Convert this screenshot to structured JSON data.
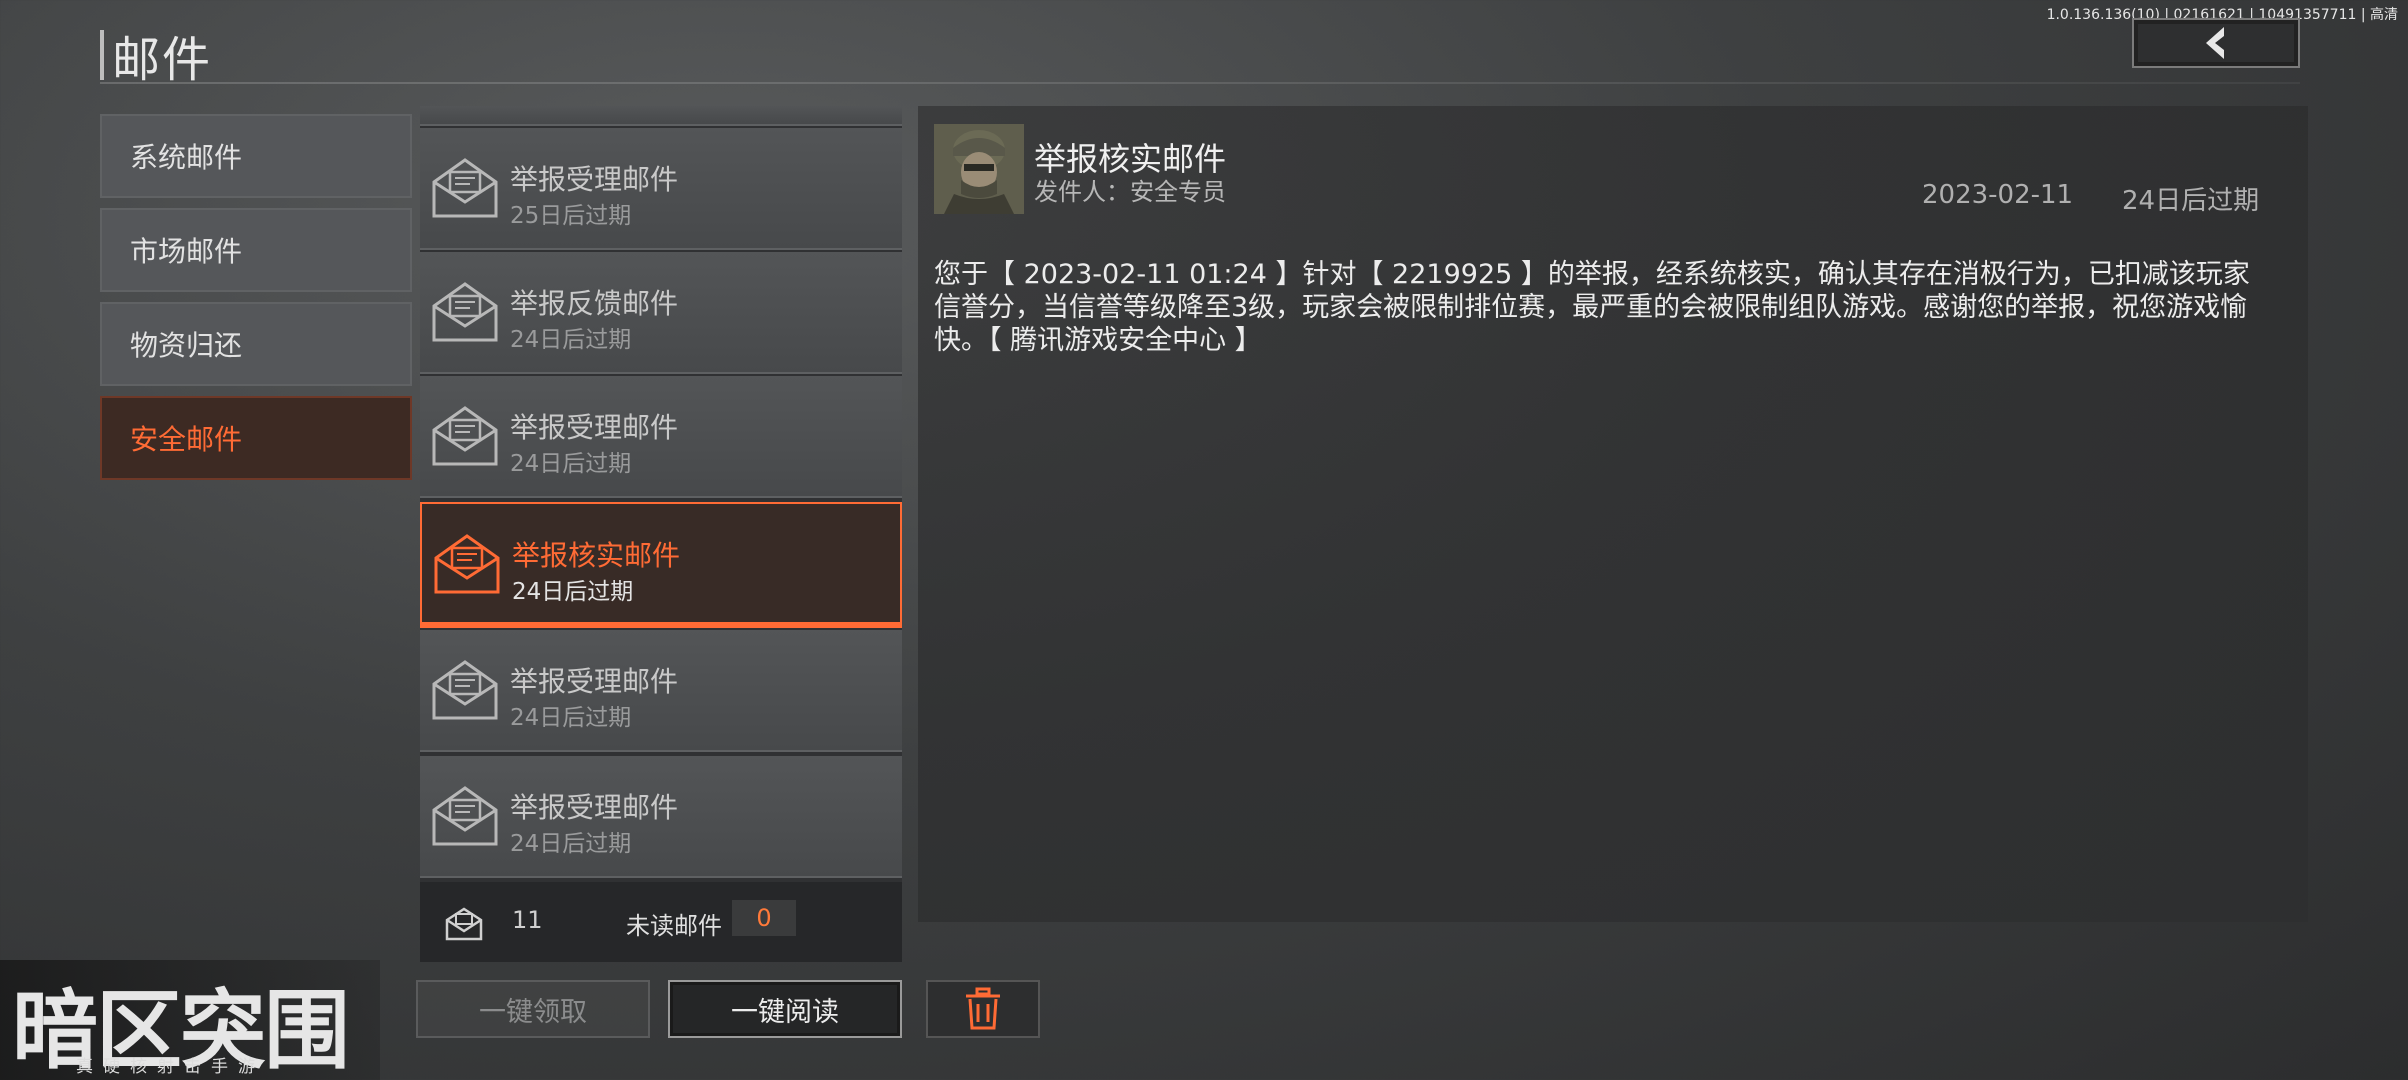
{
  "version": "1.0.136.136(10) | 02161621 | 10491357711 | 高清",
  "header": {
    "title": "邮件"
  },
  "categories": [
    {
      "label": "系统邮件"
    },
    {
      "label": "市场邮件"
    },
    {
      "label": "物资归还"
    },
    {
      "label": "安全邮件"
    }
  ],
  "mails": [
    {
      "title": "举报受理邮件",
      "expire": "25日后过期"
    },
    {
      "title": "举报反馈邮件",
      "expire": "24日后过期"
    },
    {
      "title": "举报受理邮件",
      "expire": "24日后过期"
    },
    {
      "title": "举报核实邮件",
      "expire": "24日后过期"
    },
    {
      "title": "举报受理邮件",
      "expire": "24日后过期"
    },
    {
      "title": "举报受理邮件",
      "expire": "24日后过期"
    }
  ],
  "footer": {
    "count": "11",
    "unread_label": "未读邮件",
    "unread_count": "0"
  },
  "buttons": {
    "claim_all": "一键领取",
    "read_all": "一键阅读"
  },
  "detail": {
    "title": "举报核实邮件",
    "sender": "发件人：安全专员",
    "date": "2023-02-11",
    "expire": "24日后过期",
    "body": "您于【 2023-02-11 01:24 】针对【 2219925 】的举报，经系统核实，确认其存在消极行为，已扣减该玩家信誉分，当信誉等级降至3级，玩家会被限制排位赛，最严重的会被限制组队游戏。感谢您的举报，祝您游戏愉快。【 腾讯游戏安全中心 】"
  },
  "logo": {
    "main": "暗区突围",
    "sub": "真硬核射击手游"
  },
  "colors": {
    "accent": "#ff6b35"
  }
}
